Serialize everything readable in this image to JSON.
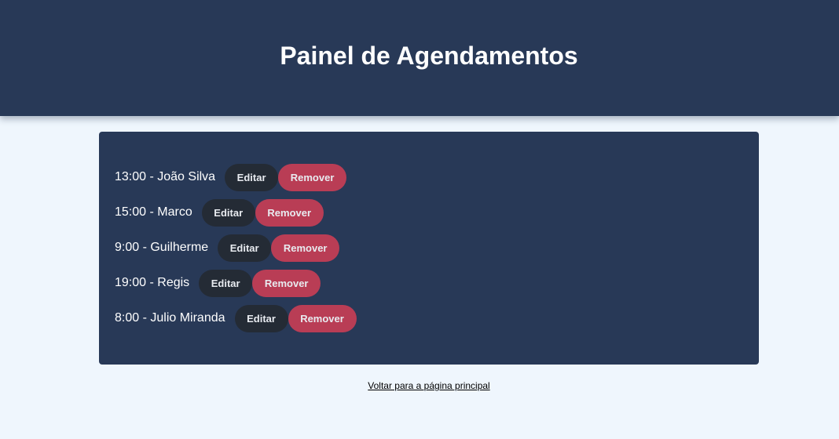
{
  "header": {
    "title": "Painel de Agendamentos"
  },
  "appointments": [
    {
      "label": "13:00 - João Silva",
      "edit_label": "Editar",
      "remove_label": "Remover"
    },
    {
      "label": "15:00 - Marco",
      "edit_label": "Editar",
      "remove_label": "Remover"
    },
    {
      "label": "9:00 - Guilherme",
      "edit_label": "Editar",
      "remove_label": "Remover"
    },
    {
      "label": "19:00 - Regis",
      "edit_label": "Editar",
      "remove_label": "Remover"
    },
    {
      "label": "8:00 - Julio Miranda",
      "edit_label": "Editar",
      "remove_label": "Remover"
    }
  ],
  "footer": {
    "back_link": "Voltar para a página principal"
  },
  "colors": {
    "header_bg": "#283957",
    "page_bg": "#eff6fd",
    "edit_button": "#242b35",
    "remove_button": "#b93d55"
  }
}
